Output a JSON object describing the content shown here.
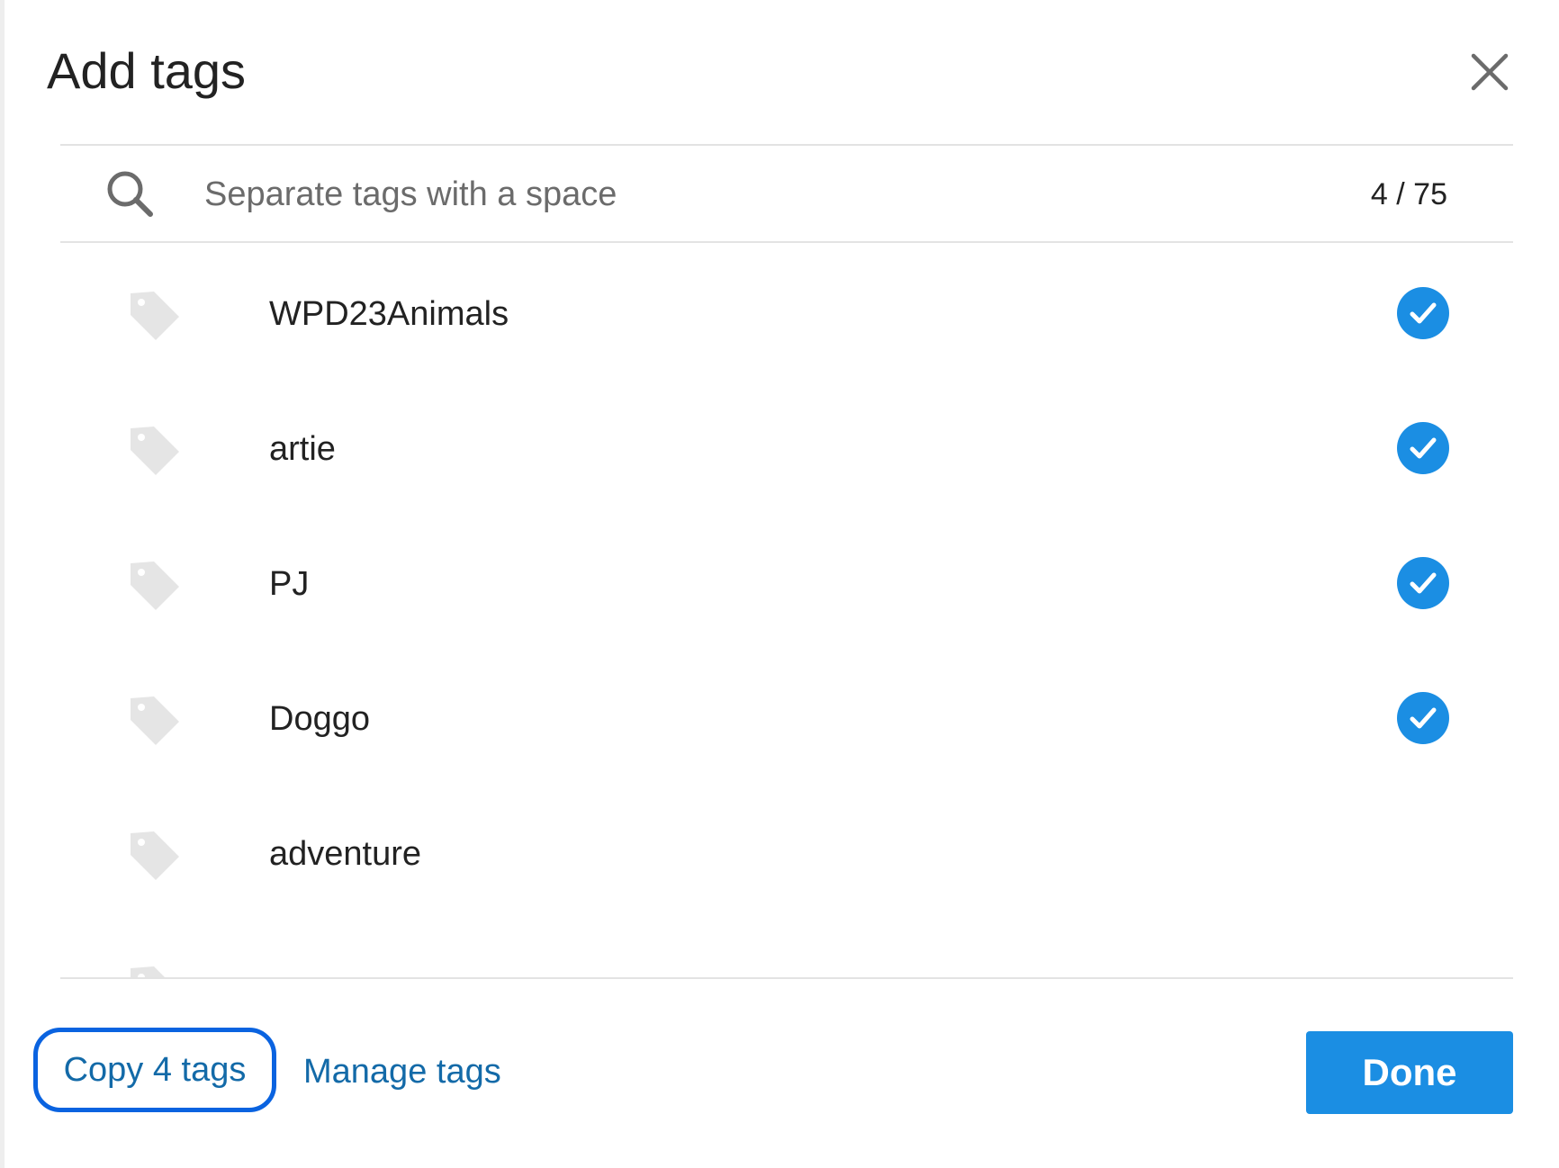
{
  "dialog": {
    "title": "Add tags",
    "close_icon": "close-icon"
  },
  "search": {
    "placeholder": "Separate tags with a space",
    "value": "",
    "counter": "4 / 75",
    "icon": "search-icon"
  },
  "tags": [
    {
      "label": "WPD23Animals",
      "selected": true
    },
    {
      "label": "artie",
      "selected": true
    },
    {
      "label": "PJ",
      "selected": true
    },
    {
      "label": "Doggo",
      "selected": true
    },
    {
      "label": "adventure",
      "selected": false
    }
  ],
  "footer": {
    "copy_label": "Copy 4 tags",
    "manage_label": "Manage tags",
    "done_label": "Done"
  },
  "colors": {
    "accent": "#1b8ee3",
    "link": "#136aa8",
    "highlight_outline": "#0a63e0",
    "tag_icon": "#e5e5e5"
  }
}
